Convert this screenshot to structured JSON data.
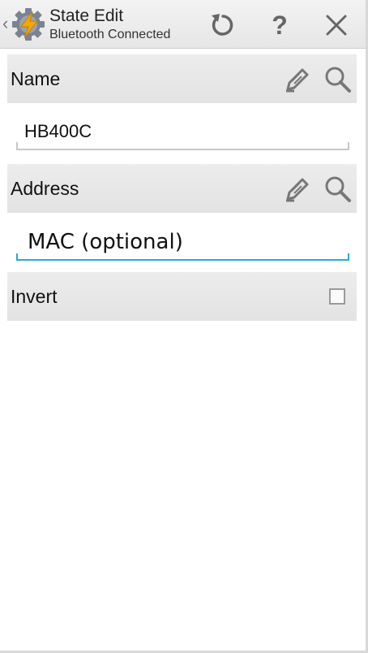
{
  "action_bar": {
    "title": "State Edit",
    "subtitle": "Bluetooth Connected",
    "icons": {
      "back": "chevron-left-icon",
      "app": "tasker-gear-lightning-icon",
      "reset": "undo-icon",
      "help": "help-icon",
      "close": "close-icon"
    }
  },
  "name_section": {
    "label": "Name",
    "value": "HB400C",
    "icons": {
      "edit": "pencil-icon",
      "search": "magnifier-icon"
    }
  },
  "address_section": {
    "label": "Address",
    "value": "",
    "placeholder": "MAC (optional)",
    "icons": {
      "edit": "pencil-icon",
      "search": "magnifier-icon"
    }
  },
  "invert": {
    "label": "Invert",
    "checked": false
  },
  "colors": {
    "accent_focus": "#2aa6dc",
    "header_bg": "#e8e8e8",
    "icon_gray": "#777777"
  }
}
